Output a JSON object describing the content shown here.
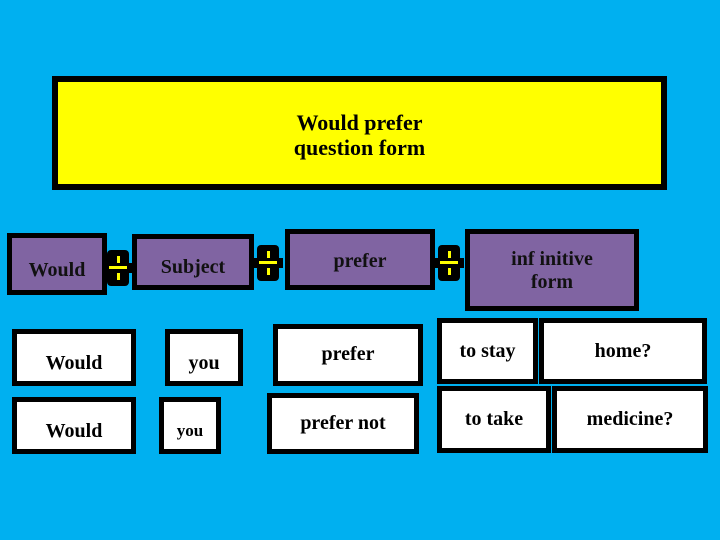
{
  "title": "Would prefer question form",
  "title_lines": [
    "Would prefer",
    "question form"
  ],
  "formula": {
    "parts": [
      "Would",
      "Subject",
      "prefer",
      "inf initive form"
    ],
    "connector": "+"
  },
  "examples": [
    {
      "would": "Would",
      "subject": "you",
      "verb": "prefer",
      "infinitive": "to stay",
      "object": "home?"
    },
    {
      "would": "Would",
      "subject": "you",
      "verb": "prefer not",
      "infinitive": "to take",
      "object": "medicine?"
    }
  ],
  "colors": {
    "background": "#00b0f0",
    "title_box": "#ffff00",
    "formula_box": "#8064a2",
    "example_box": "#ffffff",
    "plus": "#ffff00"
  }
}
